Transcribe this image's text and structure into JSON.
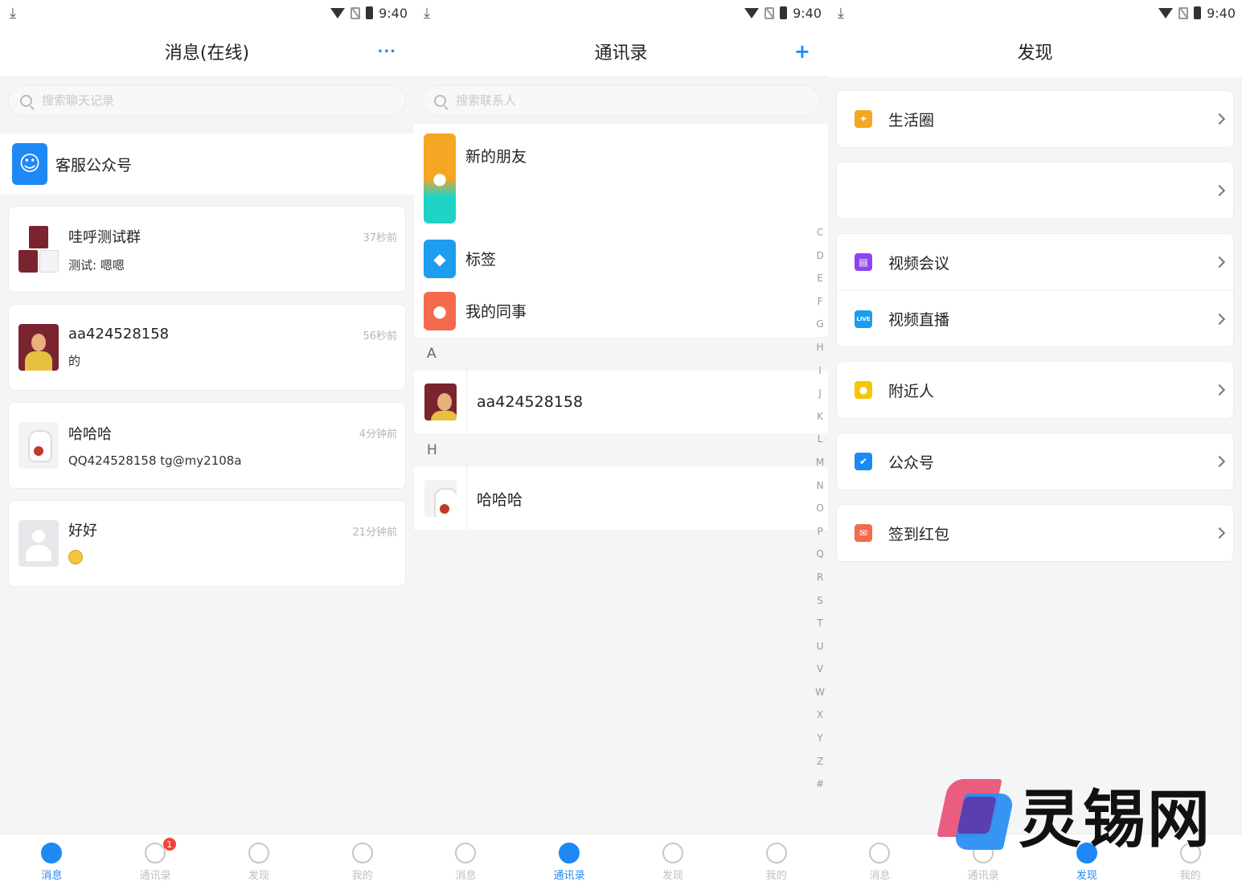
{
  "status": {
    "time": "9:40"
  },
  "messages": {
    "title": "消息(在线)",
    "more_label": "···",
    "search_placeholder": "搜索聊天记录",
    "service_label": "客服公众号",
    "chats": [
      {
        "name": "哇呼测试群",
        "preview": "测试: 嗯嗯",
        "time": "37秒前"
      },
      {
        "name": "aa424528158",
        "preview": "的",
        "time": "56秒前"
      },
      {
        "name": "哈哈哈",
        "preview": "QQ424528158 tg@my2108a",
        "time": "4分钟前"
      },
      {
        "name": "好好",
        "preview": "",
        "time": "21分钟前"
      }
    ]
  },
  "contacts": {
    "title": "通讯录",
    "add_label": "+",
    "search_placeholder": "搜索联系人",
    "entries": [
      {
        "label": "新的朋友",
        "color": "#f5a623"
      },
      {
        "label": "标签",
        "color": "#1e9cf0"
      },
      {
        "label": "我的同事",
        "color": "#f46a4e"
      }
    ],
    "sections": [
      {
        "letter": "A",
        "name": "aa424528158"
      },
      {
        "letter": "H",
        "name": "哈哈哈"
      }
    ],
    "alphabet": [
      "C",
      "D",
      "E",
      "F",
      "G",
      "H",
      "I",
      "J",
      "K",
      "L",
      "M",
      "N",
      "O",
      "P",
      "Q",
      "R",
      "S",
      "T",
      "U",
      "V",
      "W",
      "X",
      "Y",
      "Z",
      "#"
    ]
  },
  "discover": {
    "title": "发现",
    "groups": [
      [
        {
          "label": "生活圈",
          "icon": "pinwheel-icon",
          "color": "#f5a623"
        }
      ],
      [
        {
          "label": "",
          "icon": "",
          "color": "#ffffff"
        }
      ],
      [
        {
          "label": "视频会议",
          "icon": "video-meeting-icon",
          "color": "#8e44ec"
        },
        {
          "label": "视频直播",
          "icon": "live-icon",
          "color": "#1e9cf0"
        }
      ],
      [
        {
          "label": "附近人",
          "icon": "location-pin-icon",
          "color": "#f7c600"
        }
      ],
      [
        {
          "label": "公众号",
          "icon": "verified-badge-icon",
          "color": "#1e88f5"
        }
      ],
      [
        {
          "label": "签到红包",
          "icon": "red-envelope-icon",
          "color": "#f46a4e"
        }
      ]
    ]
  },
  "tabs": {
    "labels": [
      "消息",
      "通讯录",
      "发现",
      "我的"
    ],
    "badge": "1"
  },
  "watermark": {
    "text": "灵锡网"
  },
  "colors": {
    "accent": "#1e88f5",
    "badge": "#f44336"
  }
}
